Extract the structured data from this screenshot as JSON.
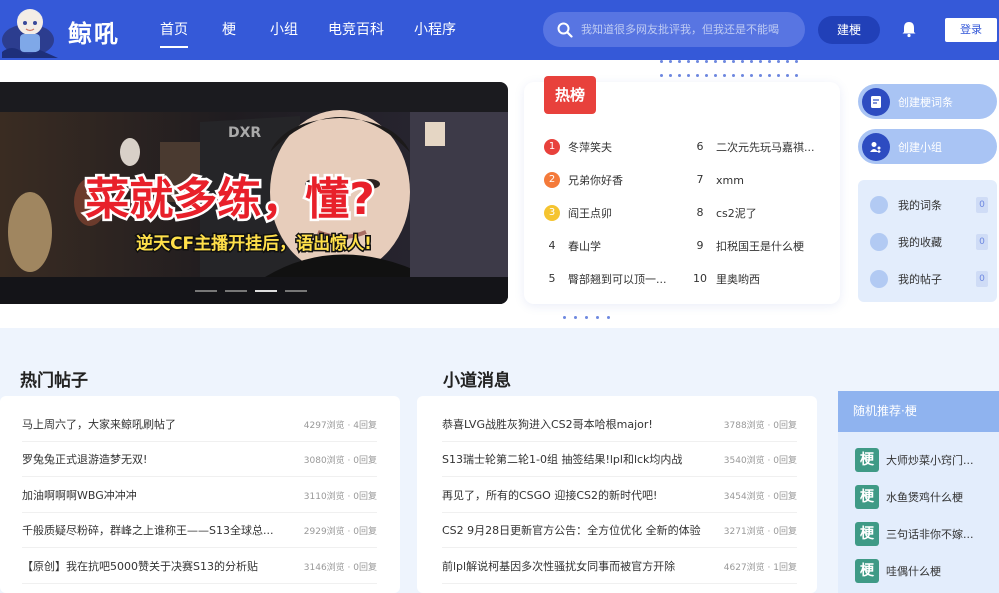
{
  "header": {
    "logo": "鲸吼",
    "nav": [
      "首页",
      "梗",
      "小组",
      "电竞百科",
      "小程序"
    ],
    "search_placeholder": "我知道很多网友批评我，但我还是不能喝",
    "create_label": "建梗",
    "login_label": "登录"
  },
  "banner": {
    "headline": "菜就多练，懂?",
    "subtitle": "逆天CF主播开挂后，语出惊人!",
    "logo_text": "DXR"
  },
  "hot": {
    "tag": "热榜",
    "items": [
      {
        "rank": "1",
        "title": "冬萍笑夫",
        "color": "#e8413c"
      },
      {
        "rank": "2",
        "title": "兄弟你好香",
        "color": "#f47a3a"
      },
      {
        "rank": "3",
        "title": "阎王点卯",
        "color": "#f5c430"
      },
      {
        "rank": "4",
        "title": "春山学"
      },
      {
        "rank": "5",
        "title": "臀部翘到可以顶一..."
      },
      {
        "rank": "6",
        "title": "二次元先玩马嘉祺..."
      },
      {
        "rank": "7",
        "title": "xmm"
      },
      {
        "rank": "8",
        "title": "cs2泥了"
      },
      {
        "rank": "9",
        "title": "扣税国王是什么梗"
      },
      {
        "rank": "10",
        "title": "里奥哟西"
      }
    ]
  },
  "actions": {
    "create_meme": "创建梗词条",
    "create_group": "创建小组"
  },
  "mine": [
    {
      "label": "我的词条",
      "count": "0"
    },
    {
      "label": "我的收藏",
      "count": "0"
    },
    {
      "label": "我的帖子",
      "count": "0"
    }
  ],
  "hot_posts": {
    "title": "热门帖子",
    "items": [
      {
        "title": "马上周六了，大家来鲸吼刷帖了",
        "meta": "4297浏览 · 4回复"
      },
      {
        "title": "罗兔兔正式退游造梦无双!",
        "meta": "3080浏览 · 0回复"
      },
      {
        "title": "加油啊啊啊WBG冲冲冲",
        "meta": "3110浏览 · 0回复"
      },
      {
        "title": "千般质疑尽粉碎，群峰之上谁称王——S13全球总...",
        "meta": "2929浏览 · 0回复"
      },
      {
        "title": "【原创】我在抗吧5000赞关于决赛S13的分析贴",
        "meta": "3146浏览 · 0回复"
      }
    ]
  },
  "news": {
    "title": "小道消息",
    "items": [
      {
        "title": "恭喜LVG战胜灰狗进入CS2哥本哈根major!",
        "meta": "3788浏览 · 0回复"
      },
      {
        "title": "S13瑞士轮第二轮1-0组 抽签结果!lpl和lck均内战",
        "meta": "3540浏览 · 0回复"
      },
      {
        "title": "再见了，所有的CSGO 迎接CS2的新时代吧!",
        "meta": "3454浏览 · 0回复"
      },
      {
        "title": "CS2 9月28日更新官方公告：全方位优化 全新的体验",
        "meta": "3271浏览 · 0回复"
      },
      {
        "title": "前lpl解说柯基因多次性骚扰女同事而被官方开除",
        "meta": "4627浏览 · 1回复"
      }
    ]
  },
  "recommend": {
    "title": "随机推荐·梗",
    "icon_char": "梗",
    "items": [
      "大师炒菜小窍门...",
      "水鱼煲鸡什么梗",
      "三句话非你不嫁...",
      "哇偶什么梗"
    ]
  }
}
